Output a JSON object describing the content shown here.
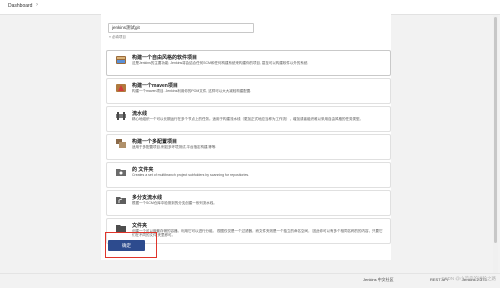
{
  "breadcrumb": {
    "item": "Dashboard",
    "separator": "›"
  },
  "form": {
    "item_name": "jenkins测试git",
    "hint": "» 必填项目"
  },
  "options": [
    {
      "title": "构建一个自由风格的软件项目",
      "desc": "这是Jenkins的主要功能. Jenkins将会结合任何SCM和任何构建系统来构建你的项目, 甚至可以构建软件以外的系统.",
      "icon": "freestyle-icon"
    },
    {
      "title": "构建一个maven项目",
      "desc": "构建一个maven项目. Jenkins利用你的POM文件, 这样可以大大减轻构建配置.",
      "icon": "maven-icon"
    },
    {
      "title": "流水线",
      "desc": "精心地组织一个可以长期运行在多个节点上的任务。适用于构建流水线（更加正式地应当称为工作流），增加或者组织难以采用自由风格的任务类型。",
      "icon": "pipeline-icon"
    },
    {
      "title": "构建一个多配置项目",
      "desc": "适用于多配置项目,例如多环境测试,平台指定构建,等等.",
      "icon": "multiconfig-icon"
    },
    {
      "title": "的 文件夹",
      "desc": "Creates a set of multibranch project subfolders by scanning for repositories.",
      "icon": "org-folder-icon"
    },
    {
      "title": "多分支流水线",
      "desc": "根据一个SCM仓库中检测到的分支创建一系列流水线。",
      "icon": "multibranch-icon"
    },
    {
      "title": "文件夹",
      "desc": "创建一个可以嵌套存储的容器。利用它可以进行分组。 视图仅仅是一个过滤器，而文件夹则是一个独立的命名空间， 因此你可以有多个相同名称的的内容，只要它们在不同的文件 夹里即可。",
      "icon": "folder-icon"
    }
  ],
  "ok_button": "确定",
  "footer": {
    "community": "Jenkins 中文社区",
    "rest_api": "REST API",
    "version": "Jenkins 2.373"
  },
  "watermark": "CSDN @小菜鸟的进阶之路",
  "colors": {
    "accent": "#2d4b8e",
    "highlight": "#e0342a"
  }
}
